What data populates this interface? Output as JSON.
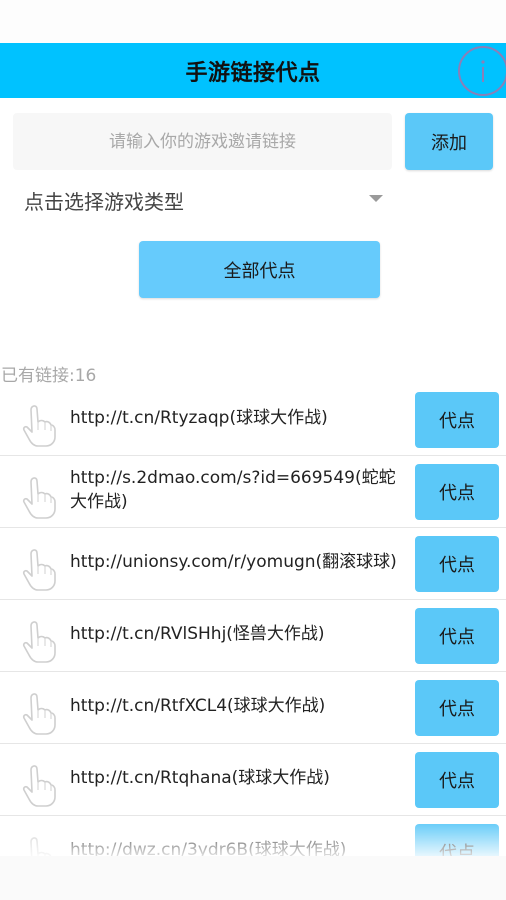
{
  "app_bar": {
    "title": "手游链接代点",
    "info_icon": "info-circle-icon"
  },
  "form": {
    "link_input_value": "",
    "link_input_placeholder": "请输入你的游戏邀请链接",
    "add_label": "添加",
    "game_type_select_label": "点击选择游戏类型",
    "all_proxy_label": "全部代点"
  },
  "links": {
    "count_prefix": "已有链接:",
    "count": "16",
    "item_icon": "hand-pointer-icon",
    "button_label": "代点",
    "items": [
      {
        "text": "http://t.cn/Rtyzaqp(球球大作战)"
      },
      {
        "text": "http://s.2dmao.com/s?id=669549(蛇蛇大作战)"
      },
      {
        "text": "http://unionsy.com/r/yomugn(翻滚球球)"
      },
      {
        "text": "http://t.cn/RVlSHhj(怪兽大作战)"
      },
      {
        "text": "http://t.cn/RtfXCL4(球球大作战)"
      },
      {
        "text": "http://t.cn/Rtqhana(球球大作战)"
      },
      {
        "text": "http://dwz.cn/3ydr6B(球球大作战)"
      }
    ]
  },
  "colors": {
    "app_bar": "#00c2ff",
    "button": "#5bc8f8",
    "input_bg": "#f7f7f7",
    "muted_text": "#a8a8a8"
  }
}
